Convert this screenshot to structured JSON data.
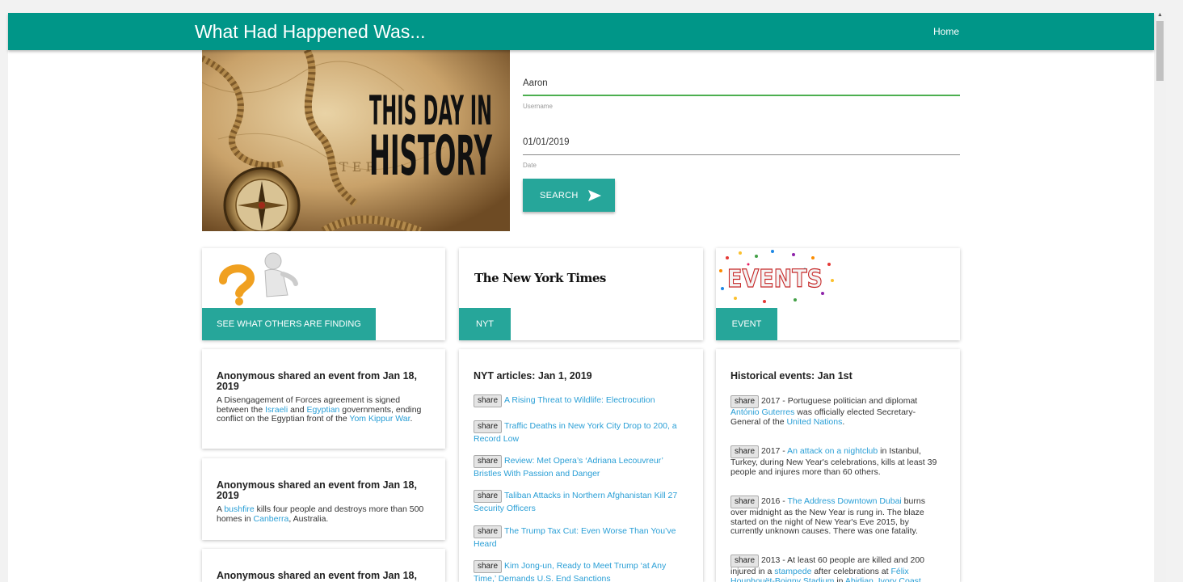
{
  "brand": "What Had Happened Was...",
  "nav": {
    "home": "Home"
  },
  "hero": {
    "line1": "THIS DAY IN",
    "line2": "HISTORY"
  },
  "form": {
    "username_value": "Aaron",
    "username_label": "Username",
    "date_value": "01/01/2019",
    "date_label": "Date",
    "search_button": "SEARCH"
  },
  "cards": {
    "others_button": "SEE WHAT OTHERS ARE FINDING",
    "nyt_logo": "The New York Times",
    "nyt_button": "NYT",
    "events_logo": "EVENTS",
    "events_button": "EVENT"
  },
  "shared": [
    {
      "title": "Anonymous shared an event from Jan 18, 2019",
      "parts": [
        {
          "t": "A Disengagement of Forces agreement is signed between the "
        },
        {
          "t": "Israeli",
          "link": true
        },
        {
          "t": " and "
        },
        {
          "t": "Egyptian",
          "link": true
        },
        {
          "t": " governments, ending conflict on the Egyptian front of the "
        },
        {
          "t": "Yom Kippur War",
          "link": true
        },
        {
          "t": "."
        }
      ]
    },
    {
      "title": "Anonymous shared an event from Jan 18, 2019",
      "parts": [
        {
          "t": "A "
        },
        {
          "t": "bushfire",
          "link": true
        },
        {
          "t": " kills four people and destroys more than 500 homes in "
        },
        {
          "t": "Canberra",
          "link": true
        },
        {
          "t": ", Australia."
        }
      ]
    },
    {
      "title": "Anonymous shared an event from Jan 18,",
      "parts": []
    }
  ],
  "nyt": {
    "heading": "NYT articles: Jan 1, 2019",
    "share_label": "share",
    "articles": [
      "A Rising Threat to Wildlife: Electrocution",
      "Traffic Deaths in New York City Drop to 200, a Record Low",
      "Review: Met Opera’s ‘Adriana Lecouvreur’ Bristles With Passion and Danger",
      "Taliban Attacks in Northern Afghanistan Kill 27 Security Officers",
      "The Trump Tax Cut: Even Worse Than You’ve Heard",
      "Kim Jong-un, Ready to Meet Trump ‘at Any Time,’ Demands U.S. End Sanctions"
    ]
  },
  "events": {
    "heading": "Historical events: Jan 1st",
    "share_label": "share",
    "items": [
      {
        "parts": [
          {
            "t": "2017 - Portuguese politician and diplomat "
          },
          {
            "t": "António Guterres",
            "link": true
          },
          {
            "t": " was officially elected Secretary-General of the "
          },
          {
            "t": "United Nations",
            "link": true
          },
          {
            "t": "."
          }
        ]
      },
      {
        "parts": [
          {
            "t": "2017 - "
          },
          {
            "t": "An attack on a nightclub",
            "link": true
          },
          {
            "t": " in Istanbul, Turkey, during New Year's celebrations, kills at least 39 people and injures more than 60 others."
          }
        ]
      },
      {
        "parts": [
          {
            "t": "2016 - "
          },
          {
            "t": "The Address Downtown Dubai",
            "link": true
          },
          {
            "t": " burns over midnight as the New Year is rung in. The blaze started on the night of New Year's Eve 2015, by currently unknown causes. There was one fatality."
          }
        ]
      },
      {
        "parts": [
          {
            "t": "2013 - At least 60 people are killed and 200 injured in a "
          },
          {
            "t": "stampede",
            "link": true
          },
          {
            "t": " after celebrations at "
          },
          {
            "t": "Félix Houphouët-Boigny Stadium",
            "link": true
          },
          {
            "t": " in "
          },
          {
            "t": "Abidjan",
            "link": true
          },
          {
            "t": ", "
          },
          {
            "t": "Ivory Coast",
            "link": true
          },
          {
            "t": "."
          }
        ]
      }
    ]
  },
  "colors": {
    "nav": "#009688",
    "button": "#26a69a",
    "link": "#2a9fd6",
    "active_underline": "#4caf50"
  }
}
